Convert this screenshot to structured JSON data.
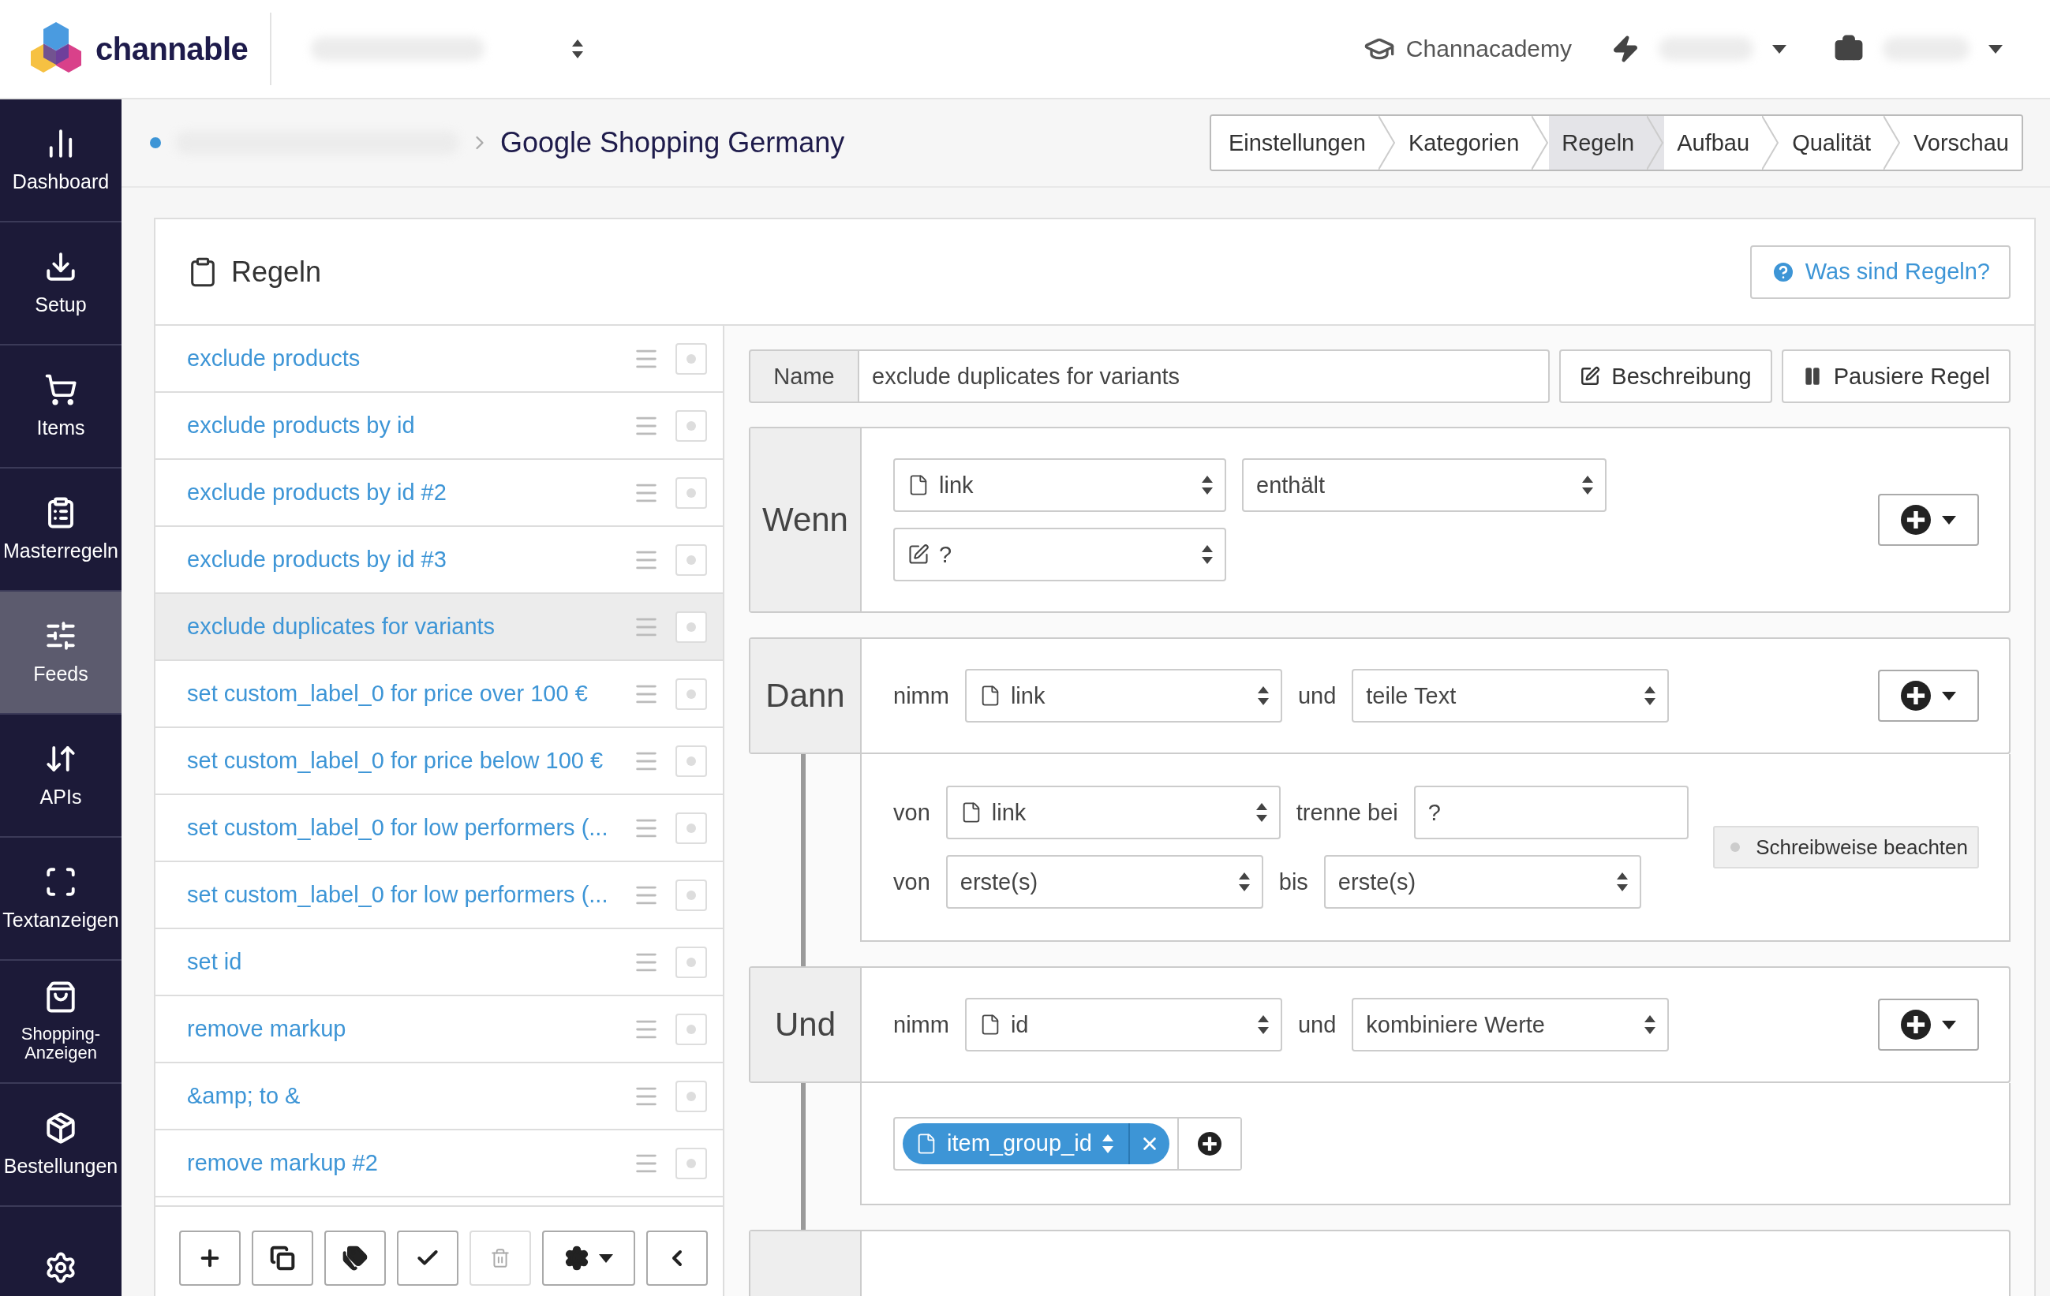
{
  "header": {
    "brand": "channable",
    "academy": "Channacademy"
  },
  "sidebar": {
    "items": [
      {
        "label": "Dashboard",
        "selected": false
      },
      {
        "label": "Setup",
        "selected": false
      },
      {
        "label": "Items",
        "selected": false
      },
      {
        "label": "Masterregeln",
        "selected": false
      },
      {
        "label": "Feeds",
        "selected": true
      },
      {
        "label": "APIs",
        "selected": false
      },
      {
        "label": "Textanzeigen",
        "selected": false
      },
      {
        "label": "Shopping-Anzeigen",
        "selected": false
      },
      {
        "label": "Bestellungen",
        "selected": false
      },
      {
        "selected": false
      }
    ]
  },
  "breadcrumb": {
    "title": "Google Shopping Germany"
  },
  "steps": [
    {
      "label": "Einstellungen",
      "selected": false
    },
    {
      "label": "Kategorien",
      "selected": false
    },
    {
      "label": "Regeln",
      "selected": true
    },
    {
      "label": "Aufbau",
      "selected": false
    },
    {
      "label": "Qualität",
      "selected": false
    },
    {
      "label": "Vorschau",
      "selected": false
    }
  ],
  "panel": {
    "title": "Regeln",
    "help": "Was sind Regeln?"
  },
  "rules": [
    {
      "name": "exclude products",
      "selected": false
    },
    {
      "name": "exclude products by id",
      "selected": false
    },
    {
      "name": "exclude products by id #2",
      "selected": false
    },
    {
      "name": "exclude products by id #3",
      "selected": false
    },
    {
      "name": "exclude duplicates for variants",
      "selected": true
    },
    {
      "name": "set custom_label_0 for price over 100 €",
      "selected": false
    },
    {
      "name": "set custom_label_0 for price below 100 €",
      "selected": false
    },
    {
      "name": "set custom_label_0 for low performers (...",
      "selected": false
    },
    {
      "name": "set custom_label_0 for low performers (...",
      "selected": false
    },
    {
      "name": "set id",
      "selected": false
    },
    {
      "name": "remove markup",
      "selected": false
    },
    {
      "name": "&amp; to &",
      "selected": false
    },
    {
      "name": "remove markup #2",
      "selected": false
    }
  ],
  "toolbar": [
    {
      "disabled": false
    },
    {
      "disabled": false
    },
    {
      "disabled": false
    },
    {
      "disabled": false
    },
    {
      "disabled": true
    },
    {
      "disabled": false
    },
    {
      "disabled": false
    }
  ],
  "editor": {
    "name_label": "Name",
    "name": "exclude duplicates for variants",
    "description_button": "Beschreibung",
    "pause_button": "Pausiere Regel",
    "blocks": [
      {
        "kind": "condition",
        "heading": "Wenn",
        "field": "link",
        "operator": "enthält",
        "value": "?"
      },
      {
        "kind": "split",
        "heading": "Dann",
        "verb": "nimm",
        "field": "link",
        "conjunction": "und",
        "action": "teile Text",
        "from_label": "von",
        "from_field": "link",
        "split_label": "trenne bei",
        "split_value": "?",
        "range_label": "von",
        "range_start": "erste(s)",
        "range_to": "bis",
        "range_end": "erste(s)",
        "case_toggle": {
          "label": "Schreibweise beachten",
          "on": false
        }
      },
      {
        "kind": "combine",
        "heading": "Und",
        "verb": "nimm",
        "field": "id",
        "conjunction": "und",
        "action": "kombiniere Werte",
        "values": [
          "item_group_id"
        ]
      },
      {
        "kind": "cut"
      }
    ]
  }
}
